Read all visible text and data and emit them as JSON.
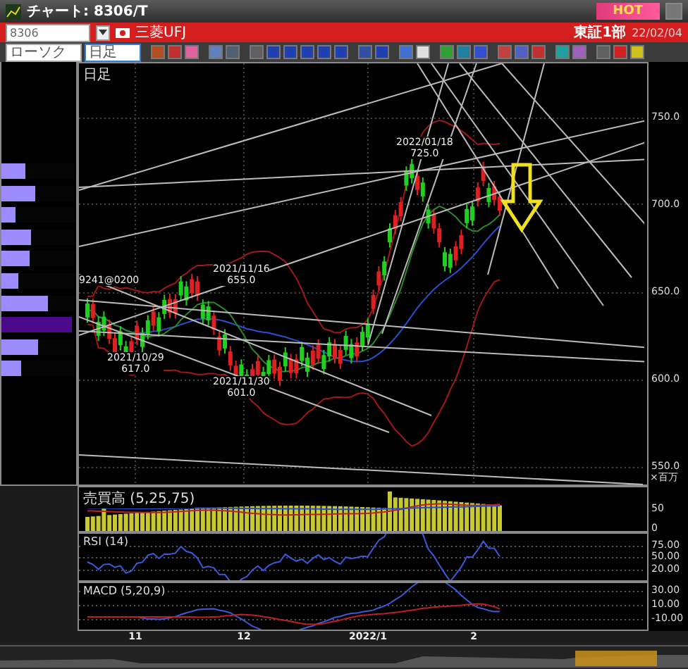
{
  "window": {
    "title": "チャート: 8306/T",
    "badge": "HOT"
  },
  "symbol_bar": {
    "code": "8306",
    "name": "三菱UFJ",
    "market": "東証1部",
    "date": "22/02/04"
  },
  "toolbar": {
    "chart_type": "ローソク",
    "period": "日足"
  },
  "main_chart": {
    "label": "日足",
    "y_ticks": [
      "750.0",
      "700.0",
      "650.0",
      "600.0",
      "550.0"
    ],
    "annotations": [
      {
        "price": "9241@0200"
      },
      {
        "date": "2021/11/16",
        "price": "655.0"
      },
      {
        "date": "2021/10/29",
        "price": "617.0"
      },
      {
        "date": "2021/11/30",
        "price": "601.0"
      },
      {
        "date": "2022/01/18",
        "price": "725.0"
      }
    ],
    "unit": "×百万"
  },
  "volume_profile": [
    {
      "level": 0.33,
      "selected": false
    },
    {
      "level": 0.46,
      "selected": false
    },
    {
      "level": 0.2,
      "selected": false
    },
    {
      "level": 0.4,
      "selected": false
    },
    {
      "level": 0.38,
      "selected": false
    },
    {
      "level": 0.24,
      "selected": false
    },
    {
      "level": 0.64,
      "selected": false
    },
    {
      "level": 0.97,
      "selected": true
    },
    {
      "level": 0.5,
      "selected": false
    },
    {
      "level": 0.26,
      "selected": false
    }
  ],
  "indicators": [
    {
      "kind": "volume",
      "title": "売買高 (5,25,75)",
      "ticks": [
        "50",
        "0"
      ]
    },
    {
      "kind": "rsi",
      "title": "RSI (14)",
      "ticks": [
        "75.00",
        "50.00",
        "20.00"
      ]
    },
    {
      "kind": "macd",
      "title": "MACD (5,20,9)",
      "ticks": [
        "30.00",
        "10.00",
        "-10.00"
      ]
    }
  ],
  "x_axis": [
    "11",
    "12",
    "2022/1",
    "2"
  ]
}
